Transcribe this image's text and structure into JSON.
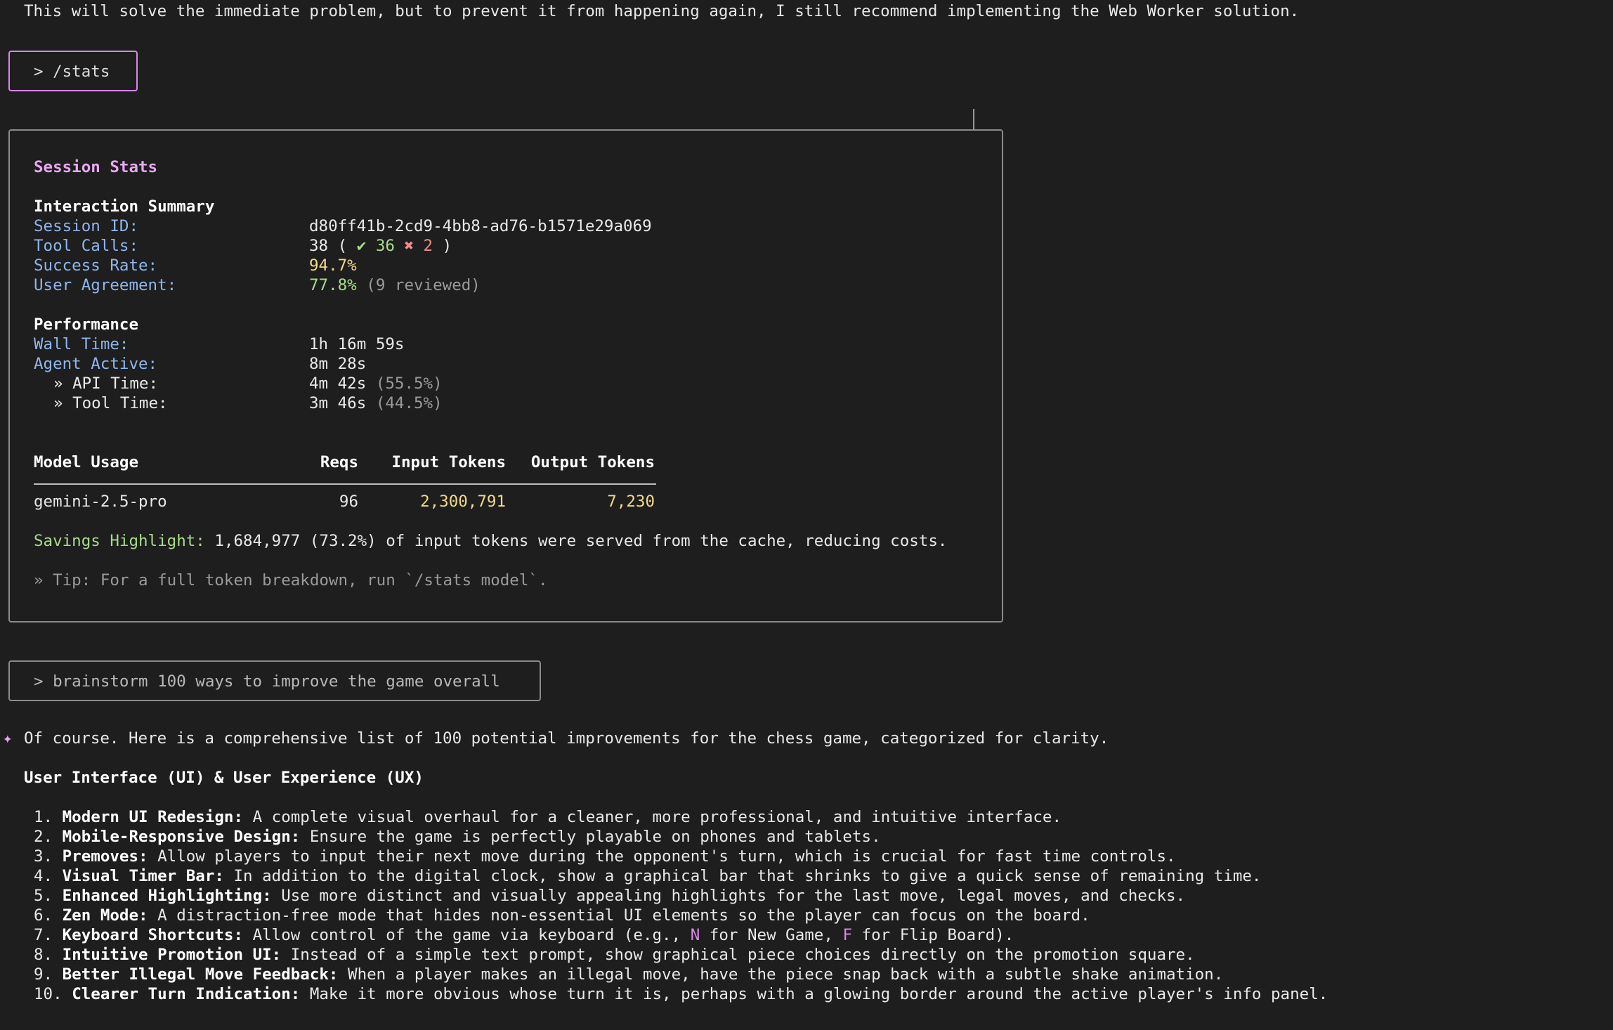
{
  "top_message": "This will solve the immediate problem, but to prevent it from happening again, I still recommend implementing the Web Worker solution.",
  "stats_prompt": "> /stats",
  "stats": {
    "title": "Session Stats",
    "interaction_header": "Interaction Summary",
    "session_id_label": "Session ID:",
    "session_id_value": "d80ff41b-2cd9-4bb8-ad76-b1571e29a069",
    "tool_calls_label": "Tool Calls:",
    "tool_calls_total": "38 (",
    "tool_calls_success": "✔ 36",
    "tool_calls_fail": "✖ 2",
    "tool_calls_close": ")",
    "success_rate_label": "Success Rate:",
    "success_rate_value": "94.7%",
    "user_agreement_label": "User Agreement:",
    "user_agreement_value": "77.8%",
    "user_agreement_note": "(9 reviewed)",
    "performance_header": "Performance",
    "wall_time_label": "Wall Time:",
    "wall_time_value": "1h 16m 59s",
    "agent_active_label": "Agent Active:",
    "agent_active_value": "8m 28s",
    "api_time_label": "» API Time:",
    "api_time_value": "4m 42s",
    "api_time_pct": "(55.5%)",
    "tool_time_label": "» Tool Time:",
    "tool_time_value": "3m 46s",
    "tool_time_pct": "(44.5%)",
    "table": {
      "headers": [
        "Model Usage",
        "Reqs",
        "Input Tokens",
        "Output Tokens"
      ],
      "rows": [
        {
          "model": "gemini-2.5-pro",
          "reqs": "96",
          "input": "2,300,791",
          "output": "7,230"
        }
      ]
    },
    "savings_label": "Savings Highlight:",
    "savings_text": "1,684,977 (73.2%) of input tokens were served from the cache, reducing costs.",
    "tip": "» Tip: For a full token breakdown, run `/stats model`."
  },
  "brainstorm_prompt": "> brainstorm 100 ways to improve the game overall",
  "response": {
    "sparkle": "✦",
    "intro": "Of course. Here is a comprehensive list of 100 potential improvements for the chess game, categorized for clarity.",
    "section_title": "User Interface (UI) & User Experience (UX)",
    "items": [
      {
        "num": "1.",
        "title": "Modern UI Redesign:",
        "text": " A complete visual overhaul for a cleaner, more professional, and intuitive interface."
      },
      {
        "num": "2.",
        "title": "Mobile-Responsive Design:",
        "text": " Ensure the game is perfectly playable on phones and tablets."
      },
      {
        "num": "3.",
        "title": "Premoves:",
        "text": " Allow players to input their next move during the opponent's turn, which is crucial for fast time controls."
      },
      {
        "num": "4.",
        "title": "Visual Timer Bar:",
        "text": " In addition to the digital clock, show a graphical bar that shrinks to give a quick sense of remaining time."
      },
      {
        "num": "5.",
        "title": "Enhanced Highlighting:",
        "text": " Use more distinct and visually appealing highlights for the last move, legal moves, and checks."
      },
      {
        "num": "6.",
        "title": "Zen Mode:",
        "text": " A distraction-free mode that hides non-essential UI elements so the player can focus on the board."
      },
      {
        "num": "7.",
        "title": "Keyboard Shortcuts:",
        "text_a": " Allow control of the game via keyboard (e.g., ",
        "key_n": "N",
        "text_b": " for New Game, ",
        "key_f": "F",
        "text_c": " for Flip Board)."
      },
      {
        "num": "8.",
        "title": "Intuitive Promotion UI:",
        "text": " Instead of a simple text prompt, show graphical piece choices directly on the promotion square."
      },
      {
        "num": "9.",
        "title": "Better Illegal Move Feedback:",
        "text": " When a player makes an illegal move, have the piece snap back with a subtle shake animation."
      },
      {
        "num": "10.",
        "title": "Clearer Turn Indication:",
        "text": " Make it more obvious whose turn it is, perhaps with a glowing border around the active player's info panel."
      }
    ]
  }
}
